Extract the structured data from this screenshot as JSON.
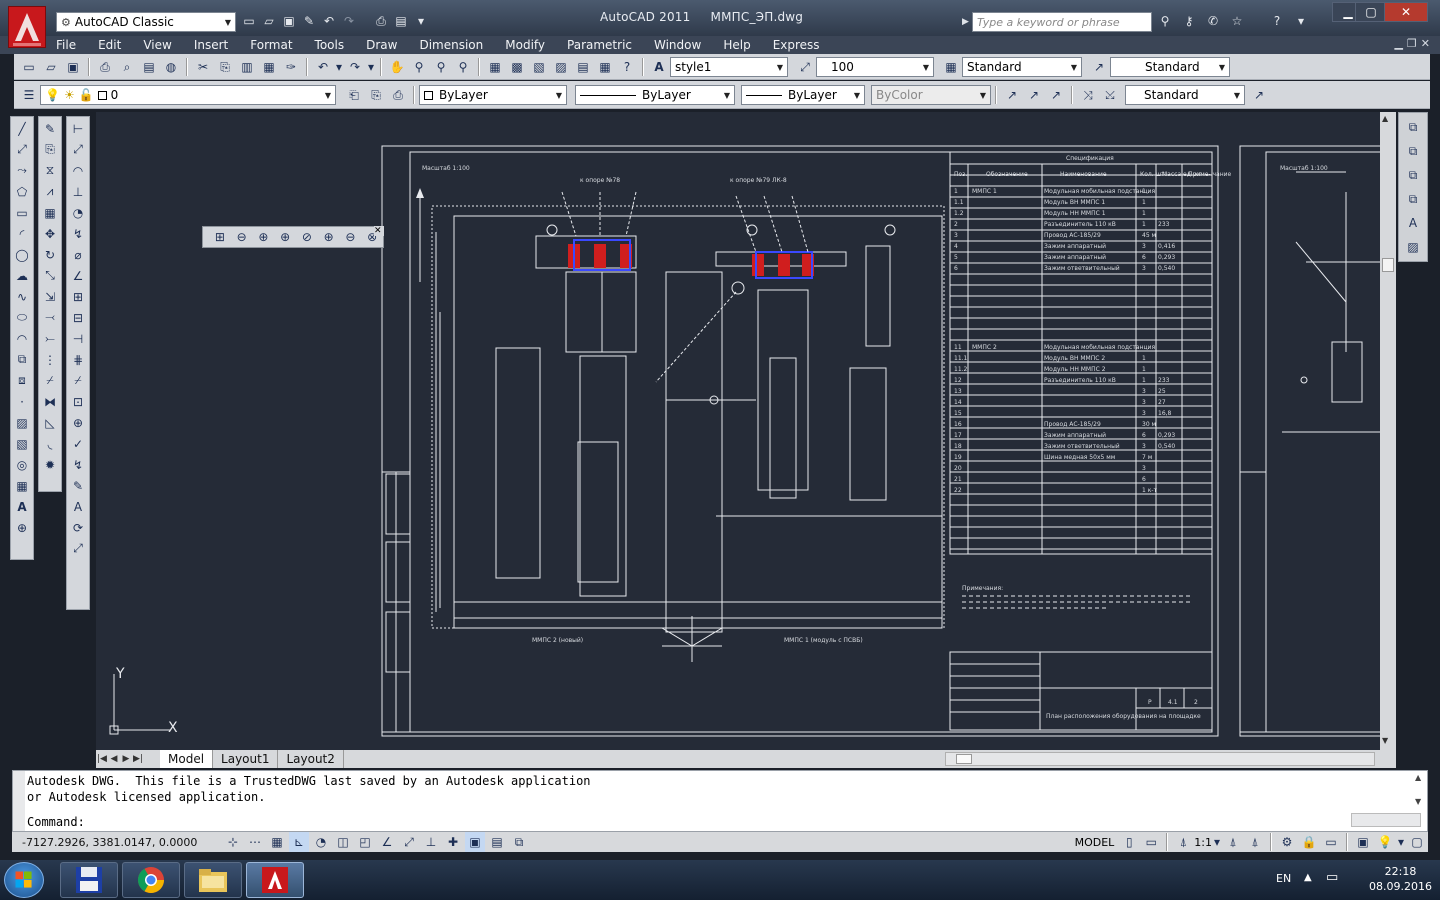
{
  "app": {
    "workspace": "AutoCAD Classic",
    "title": "AutoCAD 2011",
    "filename": "ММПС_ЭП.dwg",
    "search_placeholder": "Type a keyword or phrase",
    "accent": "#c8181c"
  },
  "menu": [
    "File",
    "Edit",
    "View",
    "Insert",
    "Format",
    "Tools",
    "Draw",
    "Dimension",
    "Modify",
    "Parametric",
    "Window",
    "Help",
    "Express"
  ],
  "styles": {
    "text_style": "style1",
    "dim_scale": "100",
    "dim_style": "Standard",
    "table_style": "Standard",
    "multileader_style": "Standard"
  },
  "layers": {
    "current_layer": "0",
    "color": "ByLayer",
    "linetype": "ByLayer",
    "lineweight": "ByLayer",
    "plot_style": "ByColor"
  },
  "layout_tabs": [
    "Model",
    "Layout1",
    "Layout2"
  ],
  "command": {
    "history_1": "Autodesk DWG.  This file is a TrustedDWG last saved by an Autodesk application",
    "history_2": "or Autodesk licensed application.",
    "prompt": "Command:"
  },
  "status": {
    "coordinates": "-7127.2926, 3381.0147, 0.0000",
    "space": "MODEL",
    "annotation_scale": "1:1"
  },
  "drawing": {
    "spec_title": "Спецификация",
    "col_pos": "Поз.",
    "col_designation": "Обозначение",
    "col_name": "Наименование",
    "col_qty": "Кол. шт.",
    "col_mass": "Масса ед. кг",
    "col_note": "Приме- чание",
    "rows": [
      {
        "pos": "1",
        "des": "ММПС 1",
        "name": "Модульная мобильная подстанция",
        "qty": "1"
      },
      {
        "pos": "1.1",
        "des": "",
        "name": "Модуль ВН ММПС 1",
        "qty": "1"
      },
      {
        "pos": "1.2",
        "des": "",
        "name": "Модуль НН ММПС 1",
        "qty": "1"
      },
      {
        "pos": "2",
        "des": "",
        "name": "Разъединитель 110 кВ",
        "qty": "1",
        "mass": "233"
      },
      {
        "pos": "3",
        "des": "",
        "name": "Провод АС-185/29",
        "qty": "45 м"
      },
      {
        "pos": "4",
        "des": "",
        "name": "Зажим аппаратный",
        "qty": "3",
        "mass": "0,416"
      },
      {
        "pos": "5",
        "des": "",
        "name": "Зажим аппаратный",
        "qty": "6",
        "mass": "0,293"
      },
      {
        "pos": "6",
        "des": "",
        "name": "Зажим ответвительный",
        "qty": "3",
        "mass": "0,540"
      }
    ],
    "rows2": [
      {
        "pos": "11",
        "des": "ММПС 2",
        "name": "Модульная мобильная подстанция"
      },
      {
        "pos": "11.1",
        "des": "",
        "name": "Модуль ВН ММПС 2",
        "qty": "1"
      },
      {
        "pos": "11.2",
        "des": "",
        "name": "Модуль НН ММПС 2",
        "qty": "1"
      },
      {
        "pos": "12",
        "des": "",
        "name": "Разъединитель 110 кВ",
        "qty": "1",
        "mass": "233"
      },
      {
        "pos": "13",
        "des": "",
        "name": "",
        "qty": "3",
        "mass": "25"
      },
      {
        "pos": "14",
        "des": "",
        "name": "",
        "qty": "3",
        "mass": "27"
      },
      {
        "pos": "15",
        "des": "",
        "name": "",
        "qty": "3",
        "mass": "16,8"
      },
      {
        "pos": "16",
        "des": "",
        "name": "Провод АС-185/29",
        "qty": "30 м"
      },
      {
        "pos": "17",
        "des": "",
        "name": "Зажим аппаратный",
        "qty": "6",
        "mass": "0,293"
      },
      {
        "pos": "18",
        "des": "",
        "name": "Зажим ответвительный",
        "qty": "3",
        "mass": "0,540"
      },
      {
        "pos": "19",
        "des": "",
        "name": "Шина медная 50х5 мм",
        "qty": "7 м"
      },
      {
        "pos": "20",
        "des": "",
        "name": "",
        "qty": "3"
      },
      {
        "pos": "21",
        "des": "",
        "name": "",
        "qty": "6"
      },
      {
        "pos": "22",
        "des": "",
        "name": "",
        "qty": "1 к-т"
      }
    ],
    "label_left": "ММПС 2 (новый)",
    "label_right": "ММПС 1 (модуль с ПСВБ)",
    "label_support_left": "к опоре №78",
    "label_support_right": "к опоре №79 ЛК-8",
    "title_block_text": "План расположения оборудования на площадке",
    "sheet_stage": "Р",
    "sheet_num": "4.1",
    "sheet_total": "2",
    "notes_title": "Примечания:",
    "scale_label": "Масштаб 1:100"
  },
  "tray": {
    "lang": "EN",
    "time": "22:18",
    "date": "08.09.2016"
  }
}
